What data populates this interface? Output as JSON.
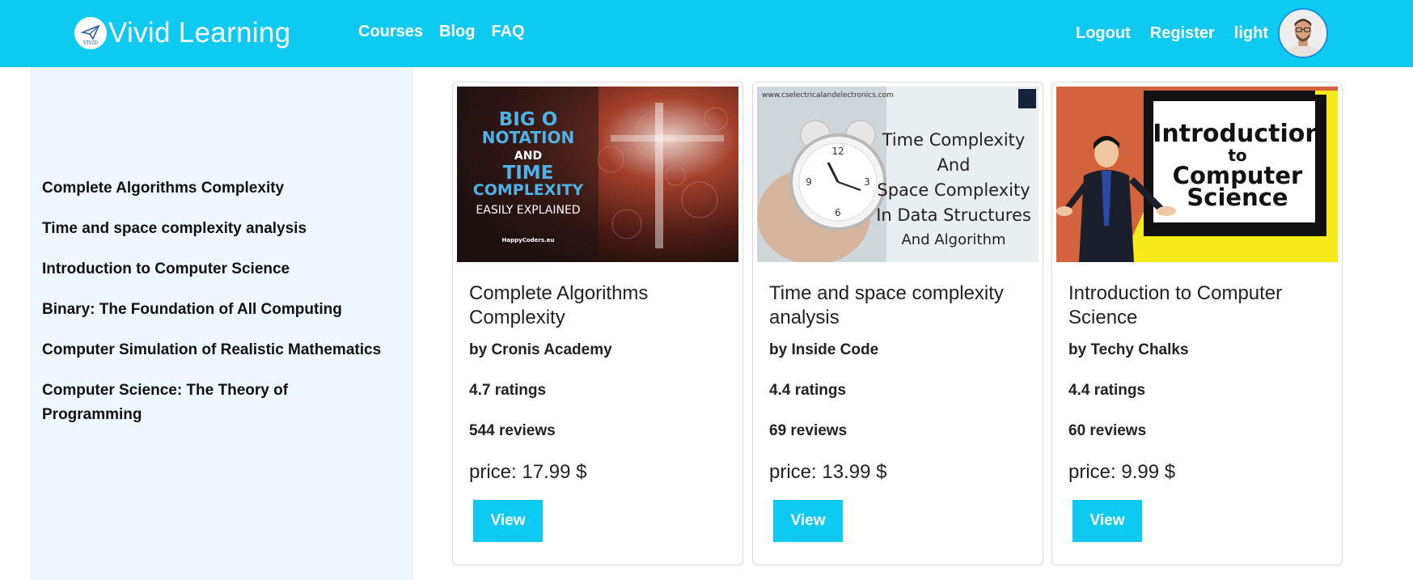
{
  "navbar": {
    "brand_name": "Vivid Learning",
    "logo_text": "VIVID",
    "links_left": [
      "Courses",
      "Blog",
      "FAQ"
    ],
    "links_right": [
      "Logout",
      "Register",
      "light"
    ],
    "accent_color": "#0fcaf0"
  },
  "sidebar": {
    "items": [
      "Complete Algorithms Complexity",
      "Time and space complexity analysis",
      "Introduction to Computer Science",
      "Binary: The Foundation of All Computing",
      "Computer Simulation of Realistic Mathematics",
      "Computer Science: The Theory of Programming"
    ]
  },
  "cards": [
    {
      "image": {
        "line1": "BIG O",
        "line2": "NOTATION",
        "line3": "AND",
        "line4": "TIME",
        "line5": "COMPLEXITY",
        "line6": "EASILY EXPLAINED",
        "badge": "HappyCoders.eu"
      },
      "title": "Complete Algorithms Complexity",
      "author": "by Cronis Academy",
      "rating": "4.7 ratings",
      "reviews": "544 reviews",
      "price": "price: 17.99 $",
      "button": "View"
    },
    {
      "image": {
        "url_text": "www.cselectricalandelectronics.com",
        "line1": "Time Complexity",
        "line2": "And",
        "line3": "Space Complexity",
        "line4": "In Data Structures",
        "line5": "And Algorithm"
      },
      "title": "Time and space complexity analysis",
      "author": "by Inside Code",
      "rating": "4.4 ratings",
      "reviews": "69 reviews",
      "price": "price: 13.99 $",
      "button": "View"
    },
    {
      "image": {
        "line1": "Introduction",
        "line2": "to",
        "line3": "Computer",
        "line4": "Science"
      },
      "title": "Introduction to Computer Science",
      "author": "by Techy Chalks",
      "rating": "4.4 ratings",
      "reviews": "60 reviews",
      "price": "price: 9.99 $",
      "button": "View"
    }
  ]
}
